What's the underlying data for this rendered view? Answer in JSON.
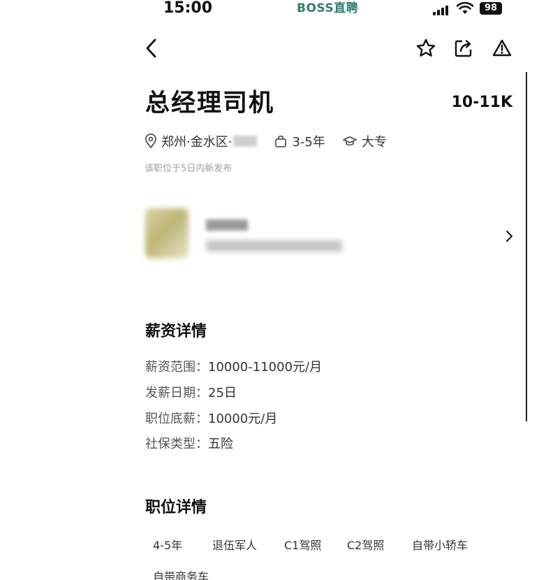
{
  "status_bar": {
    "time": "15:00",
    "watermark": "BOSS直聘",
    "battery": "98"
  },
  "nav": {
    "back_icon": "chevron-left-icon",
    "actions": [
      "star-icon",
      "share-icon",
      "report-icon"
    ]
  },
  "job": {
    "title": "总经理司机",
    "salary": "10-11K",
    "location": "郑州·金水区·",
    "experience": "3-5年",
    "education": "大专",
    "posted_note": "该职位于5日内新发布"
  },
  "salary_section": {
    "title": "薪资详情",
    "rows": [
      {
        "label": "薪资范围：",
        "value": "10000-11000元/月"
      },
      {
        "label": "发薪日期：",
        "value": "25日"
      },
      {
        "label": "职位底薪：",
        "value": "10000元/月"
      },
      {
        "label": "社保类型：",
        "value": "五险"
      }
    ]
  },
  "job_section": {
    "title": "职位详情",
    "tags": [
      "4-5年",
      "退伍军人",
      "C1驾照",
      "C2驾照",
      "自带小轿车",
      "自带商务车"
    ]
  },
  "colors": {
    "text": "#111111",
    "secondary": "#555555",
    "watermark": "#2f7d72"
  }
}
